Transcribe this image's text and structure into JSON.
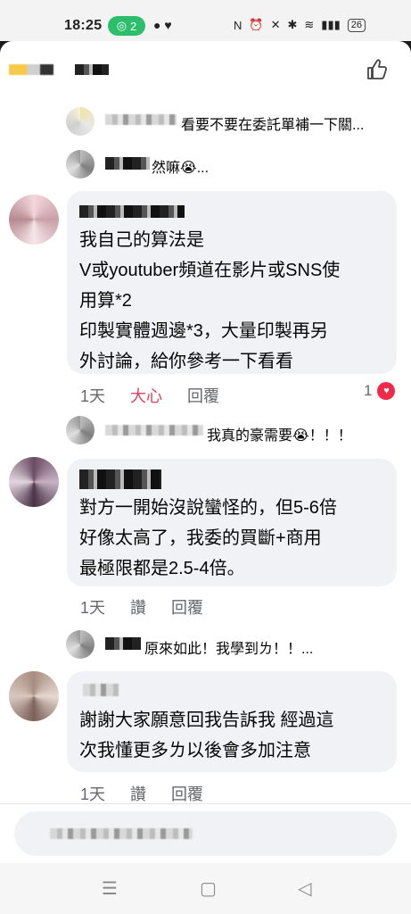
{
  "statusbar": {
    "time": "18:25",
    "hotspot_count": "2",
    "battery": "26"
  },
  "comments": [
    {
      "type": "reply",
      "text": "看要不要在委託單補一下關..."
    },
    {
      "type": "reply",
      "text": "然嘛😭..."
    },
    {
      "type": "comment",
      "lines": [
        "我自己的算法是",
        "V或youtuber頻道在影片或SNS使",
        "用算*2",
        "印製實體週邊*3，大量印製再另",
        "外討論，給你參考一下看看"
      ],
      "time": "1天",
      "reaction_label": "大心",
      "reply_label": "回覆",
      "reaction_count": "1"
    },
    {
      "type": "reply",
      "text": "我真的豪需要😭！！！"
    },
    {
      "type": "comment",
      "lines": [
        "對方一開始沒說蠻怪的，但5-6倍",
        "好像太高了，我委的買斷+商用",
        "最極限都是2.5-4倍。"
      ],
      "time": "1天",
      "reaction_label": "讚",
      "reply_label": "回覆"
    },
    {
      "type": "reply",
      "text": "原來如此！我學到ㄌ！！..."
    },
    {
      "type": "comment",
      "lines": [
        "謝謝大家願意回我告訴我 經過這",
        "次我懂更多ㄌ以後會多加注意"
      ],
      "time": "1天",
      "reaction_label": "讚",
      "reply_label": "回覆"
    }
  ],
  "icons": {
    "header": "thumbs-up-icon",
    "nav": [
      "menu-icon",
      "home-square-icon",
      "back-triangle-icon"
    ]
  },
  "colors": {
    "love": "#e4405f",
    "bubble": "#f0f2f5",
    "hotspot": "#2cbe6a"
  }
}
